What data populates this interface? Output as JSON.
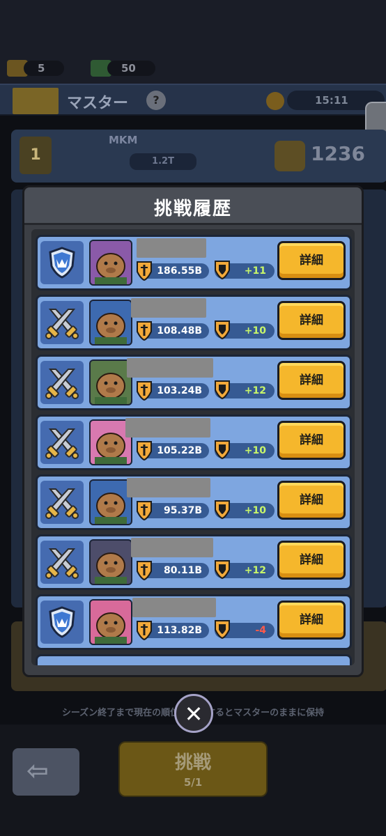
{
  "background": {
    "resources": [
      {
        "icon": "ticket-icon",
        "value": "5"
      },
      {
        "icon": "gem-icon",
        "value": "50"
      }
    ],
    "header": {
      "title": "マスター",
      "help": "?",
      "timer": "15:11"
    },
    "top_entry": {
      "rank": "1",
      "name": "MKM",
      "power": "1.2T",
      "score": "1236"
    },
    "note": "シーズン終了まで現在の順位を維持するとマスターのままに保持",
    "challenge": {
      "label": "挑戦",
      "cost": "5/1"
    }
  },
  "modal": {
    "title": "挑戦履歴",
    "rows": [
      {
        "type": "defense",
        "power": "186.55B",
        "trophy": "+11",
        "detail": "詳細"
      },
      {
        "type": "attack",
        "power": "108.48B",
        "trophy": "+10",
        "detail": "詳細"
      },
      {
        "type": "attack",
        "power": "103.24B",
        "trophy": "+12",
        "detail": "詳細"
      },
      {
        "type": "attack",
        "power": "105.22B",
        "trophy": "+10",
        "detail": "詳細"
      },
      {
        "type": "attack",
        "power": "95.37B",
        "trophy": "+10",
        "detail": "詳細"
      },
      {
        "type": "attack",
        "power": "80.11B",
        "trophy": "+12",
        "detail": "詳細"
      },
      {
        "type": "defense",
        "power": "113.82B",
        "trophy": "-4",
        "detail": "詳細"
      }
    ]
  },
  "colors": {
    "row_bg": "#7ea6e0",
    "button": "#f5b72c",
    "positive": "#c7f56a",
    "negative": "#ff5a4a"
  }
}
